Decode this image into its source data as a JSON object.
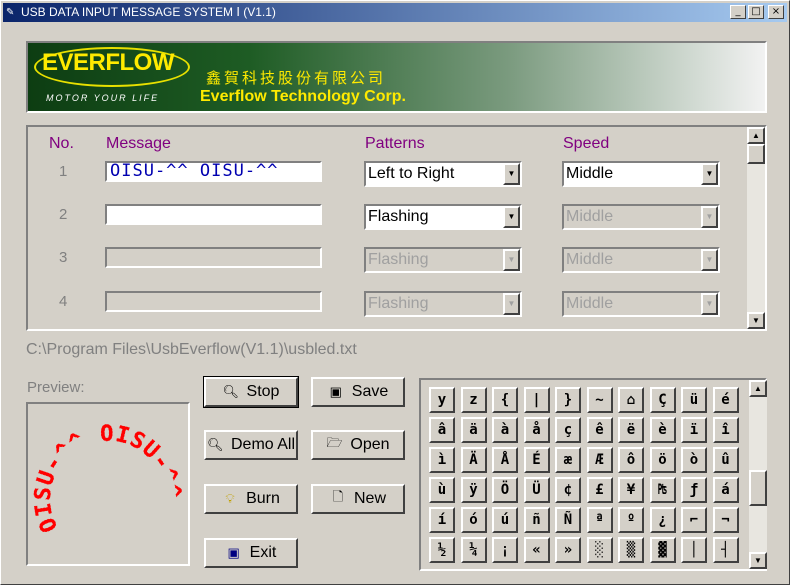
{
  "window": {
    "title": "USB DATA INPUT MESSAGE SYSTEM Ⅰ (V1.1)",
    "minimize": "_",
    "maximize": "□",
    "close": "×"
  },
  "banner": {
    "logo": "EVERFLOW",
    "tagline": "MOTOR YOUR LIFE",
    "company_cn": "鑫賀科技股份有限公司",
    "company_en": "Everflow Technology Corp."
  },
  "grid": {
    "headers": {
      "no": "No.",
      "message": "Message",
      "patterns": "Patterns",
      "speed": "Speed"
    },
    "rows": [
      {
        "no": "1",
        "message": "OISU-^^ OISU-^^",
        "pattern": "Left to Right",
        "speed": "Middle",
        "enabled": true,
        "speed_enabled": true
      },
      {
        "no": "2",
        "message": "",
        "pattern": "Flashing",
        "speed": "Middle",
        "enabled": true,
        "speed_enabled": false
      },
      {
        "no": "3",
        "message": "",
        "pattern": "Flashing",
        "speed": "Middle",
        "enabled": false,
        "speed_enabled": false
      },
      {
        "no": "4",
        "message": "",
        "pattern": "Flashing",
        "speed": "Middle",
        "enabled": false,
        "speed_enabled": false
      }
    ]
  },
  "file_path": "C:\\Program Files\\UsbEverflow(V1.1)\\usbled.txt",
  "preview": {
    "label": "Preview:",
    "text": "OISU-^^ OISU-^^",
    "color": "#ff0000"
  },
  "buttons": {
    "stop": "Stop",
    "save": "Save",
    "demo_all": "Demo All",
    "open": "Open",
    "burn": "Burn",
    "new": "New",
    "exit": "Exit"
  },
  "charmap": [
    [
      "y",
      "z",
      "{",
      "|",
      "}",
      "~",
      "⌂",
      "Ç",
      "ü",
      "é"
    ],
    [
      "â",
      "ä",
      "à",
      "å",
      "ç",
      "ê",
      "ë",
      "è",
      "ï",
      "î"
    ],
    [
      "ì",
      "Ä",
      "Å",
      "É",
      "æ",
      "Æ",
      "ô",
      "ö",
      "ò",
      "û"
    ],
    [
      "ù",
      "ÿ",
      "Ö",
      "Ü",
      "¢",
      "£",
      "¥",
      "₧",
      "ƒ",
      "á"
    ],
    [
      "í",
      "ó",
      "ú",
      "ñ",
      "Ñ",
      "ª",
      "º",
      "¿",
      "⌐",
      "¬"
    ],
    [
      "½",
      "¼",
      "¡",
      "«",
      "»",
      "░",
      "▒",
      "▓",
      "│",
      "┤"
    ]
  ]
}
